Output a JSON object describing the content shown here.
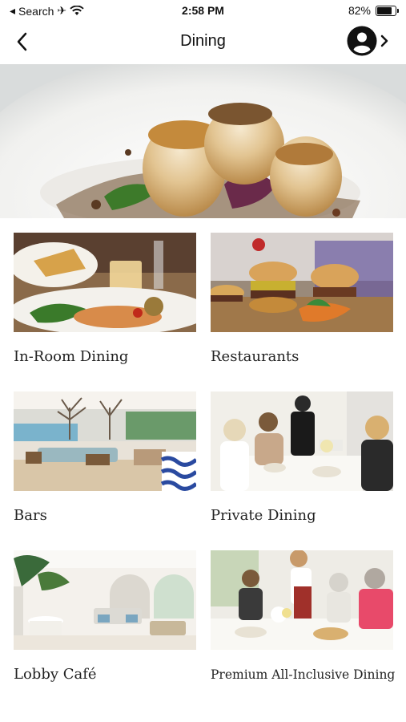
{
  "status_bar": {
    "back_app": "Search",
    "time": "2:58 PM",
    "battery": "82%",
    "battery_level": 0.82
  },
  "header": {
    "title": "Dining",
    "back_icon": "chevron-left-icon",
    "profile_icon": "user-avatar-icon"
  },
  "categories": [
    {
      "label": "In-Room Dining"
    },
    {
      "label": "Restaurants"
    },
    {
      "label": "Bars"
    },
    {
      "label": "Private Dining"
    },
    {
      "label": "Lobby Café"
    },
    {
      "label": "Premium All-Inclusive Dining"
    }
  ]
}
